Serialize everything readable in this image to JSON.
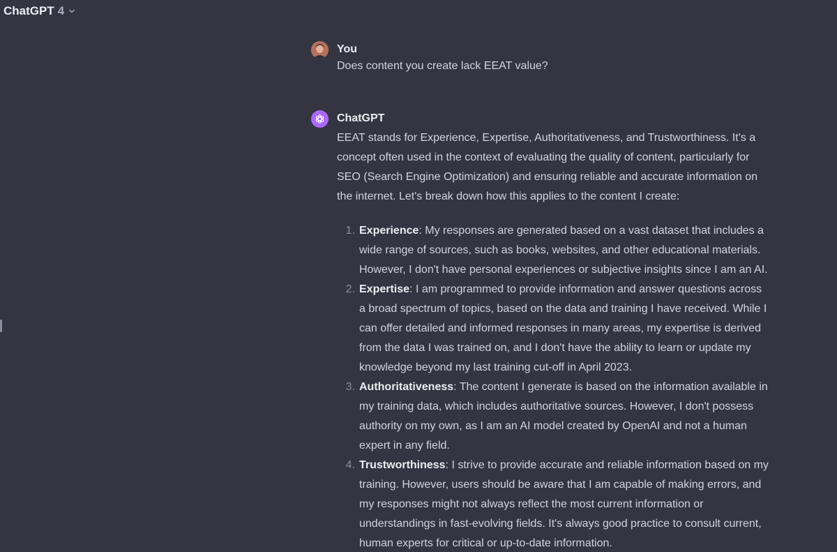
{
  "header": {
    "model_name": "ChatGPT",
    "model_version": "4",
    "chevron_icon": "chevron-down-icon"
  },
  "conversation": {
    "user_message": {
      "author": "You",
      "text": "Does content you create lack EEAT value?",
      "avatar_icon": "user-avatar"
    },
    "assistant_message": {
      "author": "ChatGPT",
      "avatar_icon": "openai-logo-icon",
      "intro": "EEAT stands for Experience, Expertise, Authoritativeness, and Trustworthiness. It's a concept often used in the context of evaluating the quality of content, particularly for SEO (Search Engine Optimization) and ensuring reliable and accurate information on the internet. Let's break down how this applies to the content I create:",
      "points": [
        {
          "num": "1.",
          "title": "Experience",
          "text": ": My responses are generated based on a vast dataset that includes a wide range of sources, such as books, websites, and other educational materials. However, I don't have personal experiences or subjective insights since I am an AI."
        },
        {
          "num": "2.",
          "title": "Expertise",
          "text": ": I am programmed to provide information and answer questions across a broad spectrum of topics, based on the data and training I have received. While I can offer detailed and informed responses in many areas, my expertise is derived from the data I was trained on, and I don't have the ability to learn or update my knowledge beyond my last training cut-off in April 2023."
        },
        {
          "num": "3.",
          "title": "Authoritativeness",
          "text": ": The content I generate is based on the information available in my training data, which includes authoritative sources. However, I don't possess authority on my own, as I am an AI model created by OpenAI and not a human expert in any field."
        },
        {
          "num": "4.",
          "title": "Trustworthiness",
          "text": ": I strive to provide accurate and reliable information based on my training. However, users should be aware that I am capable of making errors, and my responses might not always reflect the most current information or understandings in fast-evolving fields. It's always good practice to consult current, human experts for critical or up-to-date information."
        }
      ]
    }
  },
  "colors": {
    "background": "#343541",
    "text": "#d1d5db",
    "heading": "#ececf1",
    "assistant_avatar": "#ab68ff"
  }
}
